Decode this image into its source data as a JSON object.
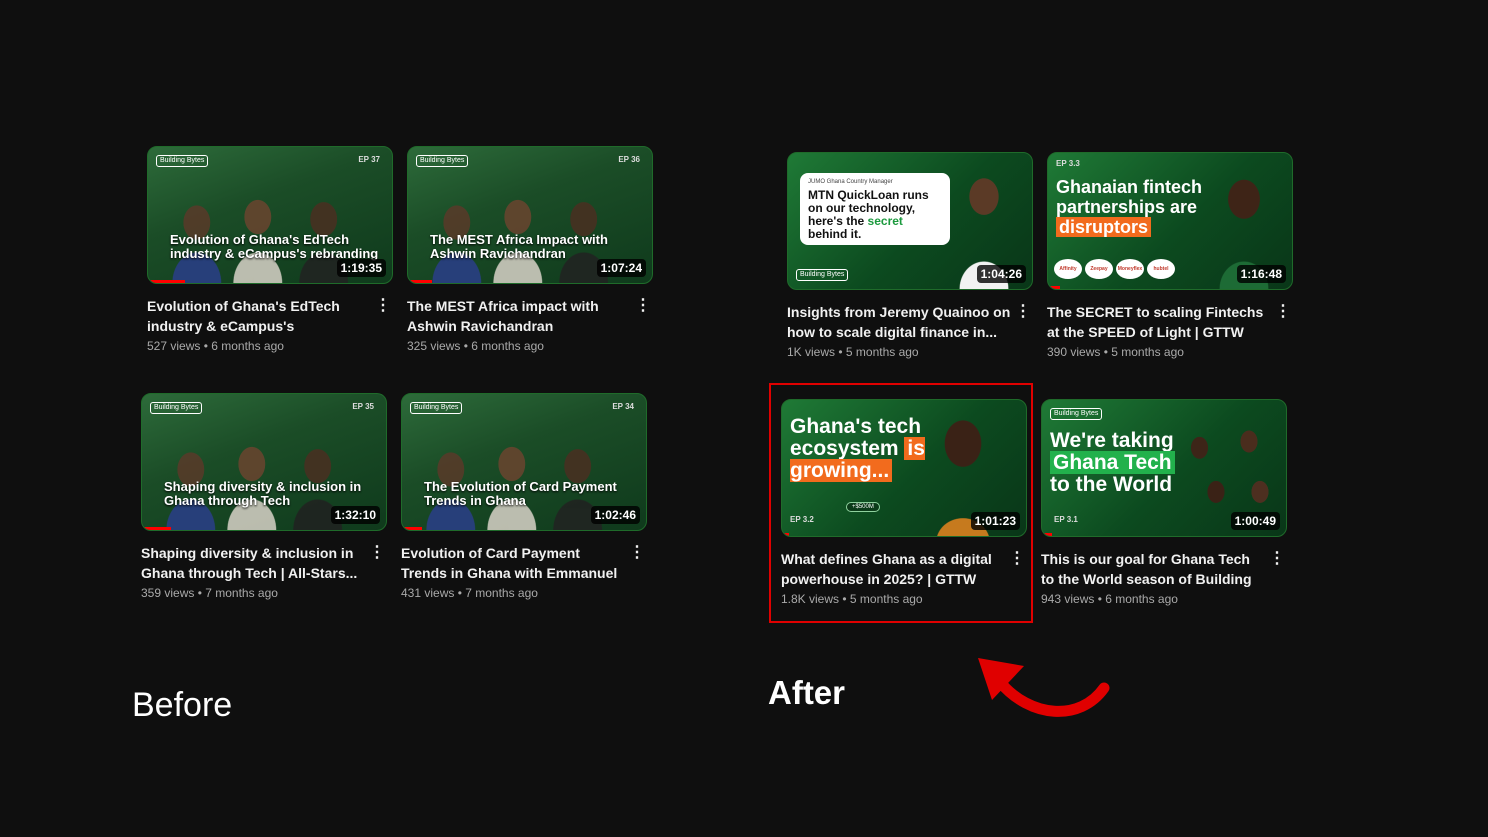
{
  "labels": {
    "before": "Before",
    "after": "After"
  },
  "before": [
    {
      "overlay": "Evolution of Ghana's EdTech industry & eCampus's rebranding",
      "ep": "EP 37",
      "logo": "Building Bytes",
      "duration": "1:19:35",
      "progress": 0.15,
      "title": "Evolution of Ghana's EdTech industry & eCampus's rebranding...",
      "sub": "527 views • 6 months ago"
    },
    {
      "overlay": "The MEST Africa Impact with Ashwin Ravichandran",
      "ep": "EP 36",
      "logo": "Building Bytes",
      "duration": "1:07:24",
      "progress": 0.1,
      "title": "The MEST Africa impact with Ashwin Ravichandran",
      "sub": "325 views • 6 months ago"
    },
    {
      "overlay": "Shaping diversity & inclusion in Ghana through Tech",
      "ep": "EP 35",
      "logo": "Building Bytes",
      "duration": "1:32:10",
      "progress": 0.12,
      "title": "Shaping diversity & inclusion in Ghana through Tech | All-Stars...",
      "sub": "359 views • 7 months ago"
    },
    {
      "overlay": "The Evolution of Card Payment Trends in Ghana",
      "ep": "EP 34",
      "logo": "Building Bytes",
      "duration": "1:02:46",
      "progress": 0.08,
      "title": "Evolution of Card Payment Trends in Ghana with Emmanuel Sarpong-...",
      "sub": "431 views • 7 months ago"
    }
  ],
  "after": [
    {
      "who": "JUMO Ghana Country Manager",
      "quote_a": "MTN QuickLoan runs on our technology, here's the ",
      "quote_g": "secret",
      "quote_b": " behind it.",
      "logo": "Building Bytes",
      "duration": "1:04:26",
      "progress": 0.0,
      "title": "Insights from Jeremy Quainoo on how to scale digital finance in...",
      "sub": "1K views • 5 months ago"
    },
    {
      "ep": "EP 3.3",
      "big_a": "Ghanaian fintech partnerships are ",
      "big_hl": "disruptors",
      "chips": [
        "Affinity",
        "Zeepay",
        "Moneyflex",
        "hubtel"
      ],
      "duration": "1:16:48",
      "progress": 0.05,
      "title": "The SECRET to scaling Fintechs at the SPEED of Light | GTTW",
      "sub": "390 views • 5 months ago"
    },
    {
      "ep": "EP 3.2",
      "big_a": "Ghana's tech ecosystem ",
      "big_hl": "is growing...",
      "money": "+$500M",
      "duration": "1:01:23",
      "progress": 0.03,
      "title": "What defines Ghana as a digital powerhouse in 2025? | GTTW",
      "sub": "1.8K views • 5 months ago"
    },
    {
      "ep": "EP 3.1",
      "logo": "Building Bytes",
      "big_a": "We're taking ",
      "big_hl": "Ghana Tech",
      "big_b": " to the World",
      "duration": "1:00:49",
      "progress": 0.04,
      "title": "This is our goal for Ghana Tech to the World season of Building Byte...",
      "sub": "943 views • 6 months ago"
    }
  ],
  "colors": {
    "background": "#0f0f0f",
    "progress": "#ff0000",
    "highlight": "#e00000",
    "accent_green": "#22b14c"
  }
}
